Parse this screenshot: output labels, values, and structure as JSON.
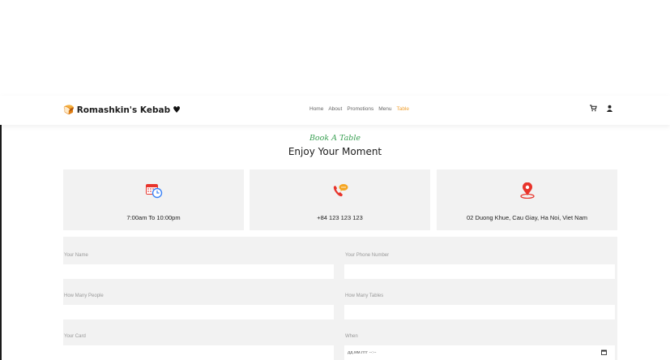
{
  "header": {
    "brand": "Romashkin's Kebab",
    "nav": [
      "Home",
      "About",
      "Promotions",
      "Menu",
      "Table"
    ],
    "active_nav": "Table",
    "icons": [
      "cart-icon",
      "user-icon"
    ]
  },
  "heading": {
    "subtitle": "Book A Table",
    "title": "Enjoy Your Moment"
  },
  "info_cards": [
    {
      "icon": "calendar-clock-icon",
      "text": "7:00am To 10:00pm"
    },
    {
      "icon": "phone-icon",
      "text": "+84 123 123 123"
    },
    {
      "icon": "location-pin-icon",
      "text": "02 Duong Khue, Cau Giay, Ha Noi, Viet Nam"
    }
  ],
  "form": {
    "name_label": "Your Name",
    "phone_label": "Your Phone Number",
    "people_label": "How Many People",
    "tables_label": "How Many Tables",
    "card_label": "Your Card",
    "when_label": "When",
    "when_placeholder": "дд.мм.гггг --:--"
  },
  "colors": {
    "accent": "#f0a030",
    "subtitle_green": "#3aa053",
    "card_bg": "#f2f2f2",
    "icon_red": "#e8342b"
  }
}
